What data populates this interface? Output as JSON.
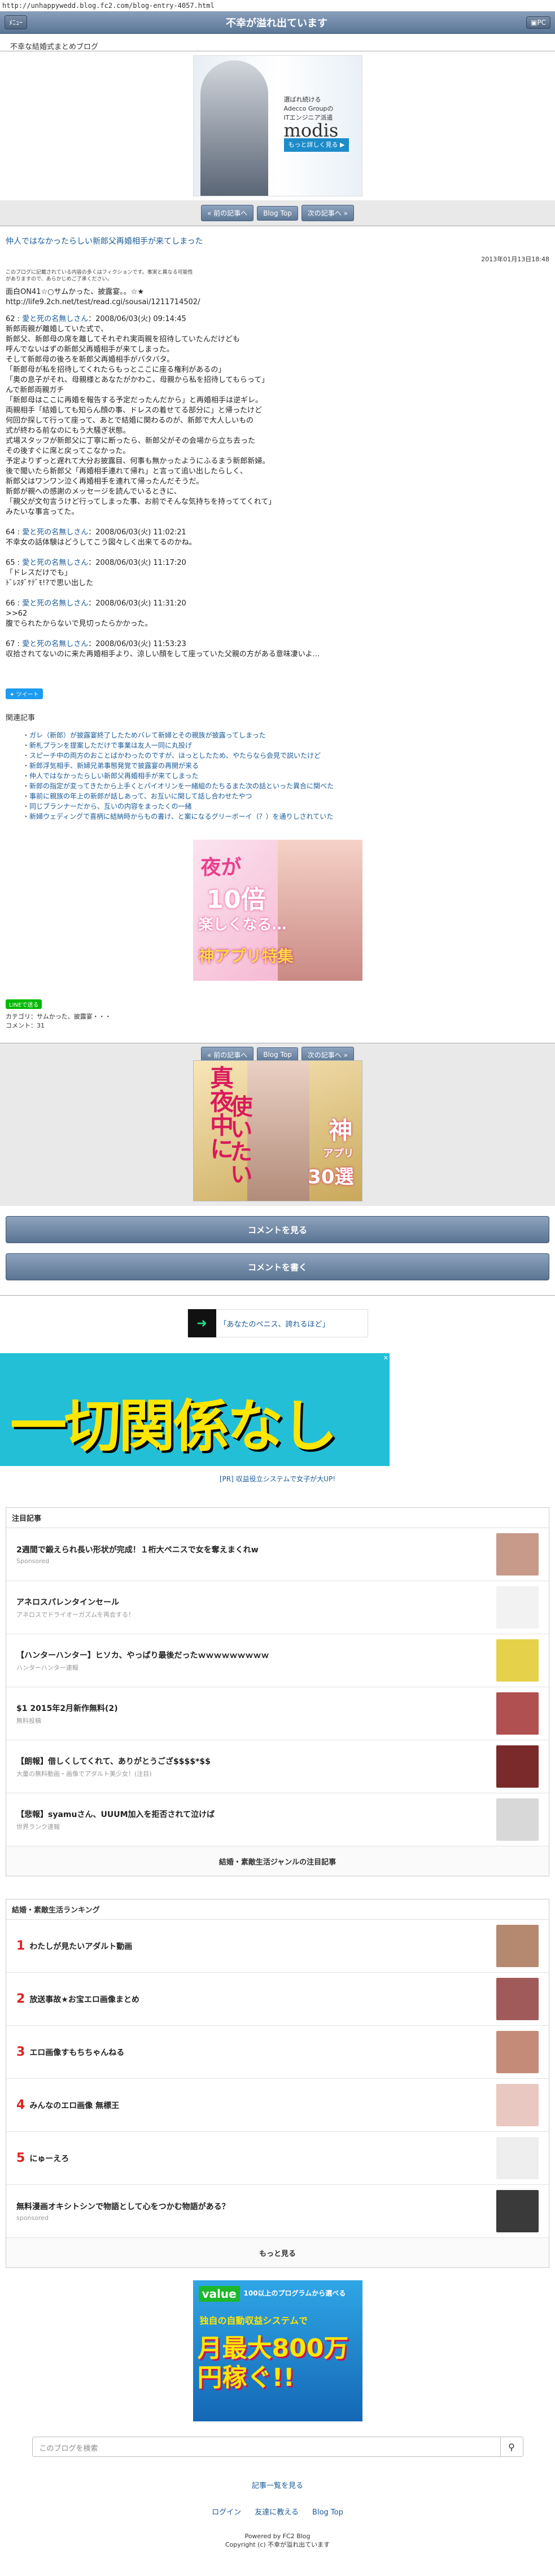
{
  "url": "http://unhappywedd.blog.fc2.com/blog-entry-4057.html",
  "header": {
    "left": "ﾒﾆｭｰ",
    "title": "不幸が溢れ出ています",
    "right": "PC"
  },
  "site_desc": "不幸な結婚式まとめブログ",
  "ad1": {
    "line1": "選ばれ続ける",
    "line2": "Adecco Groupの",
    "line3": "ITエンジニア派遣",
    "brand": "modis",
    "cta": "もっと詳しく見る ▶"
  },
  "pager": {
    "prev": "« 前の記事へ",
    "top": "Blog Top",
    "next": "次の記事へ »"
  },
  "entry": {
    "title": "仲人ではなかったらしい新郎父再婚相手が来てしまった",
    "date": "2013年01月13日18:48",
    "disclaimer": "このブログに記載されている内容の多くはフィクションです。事実と異なる可能性がありますので、あらかじめご了承ください。",
    "src_head": "面白ON41☆○サムかった、披露宴。。☆★",
    "src_url": "http://life9.2ch.net/test/read.cgi/sousai/1211714502/",
    "p1_header": "62 : ",
    "p1_name": "愛と死の名無しさん",
    "p1_date": "：2008/06/03(火) 09:14:45",
    "p1": [
      "新郎両親が離婚していた式で、",
      "新郎父、新郎母の席を離してそれぞれ実両親を招待していたんだけども",
      "呼んでないはずの新郎父再婚相手が来てしまった。",
      "そして新郎母の後ろを新郎父再婚相手がバタバタ。",
      "「新郎母が私を招待してくれたらもっとここに座る権利があるの」",
      "「奥の息子がそれ、母親様とあなたがかわこ、母親から私を招待してもらって」",
      "んで新郎両親ガチ",
      "「新郎母はここに再婚を報告する予定だったんだから」と再婚相手は逆ギレ。",
      "両親相手「結婚しても知らん顔の事、ドレスの着せてる部分に」と帰ったけど",
      "何回か探して行って座って、あとで結婚に関わるのが、新郎で大人しいもの",
      "式が終わる前なのにもう大騒ぎ状態。",
      "式場スタッフが新郎父に丁寧に断ったら、新郎父がその会場から立ち去った",
      "その後すぐに席と戻ってこなかった。",
      "予定よりずっと遅れて大分お披露目、何事も無かったようにふるまう新郎新婦。",
      "後で聞いたら新郎父「再婚相手連れて帰れ」と言って追い出したらしく、",
      "新郎父はワンワン泣く再婚相手を連れて帰ったんだそうだ。",
      "新郎が親への感謝のメッセージを読んでいるときに、",
      "「親父が文句言うけど行ってしまった事、お前でそんな気持ちを持っててくれて」",
      "みたいな事言ってた。"
    ],
    "p2_header": "64 : ",
    "p2_name": "愛と死の名無しさん",
    "p2_date": "：2008/06/03(火) 11:02:21",
    "p2": [
      "不幸女の話体験はどうしてこう図々しく出来てるのかね。"
    ],
    "p3_header": "65 : ",
    "p3_name": "愛と死の名無しさん",
    "p3_date": "：2008/06/03(火) 11:17:20",
    "p3": [
      "「ドレスだけでも」",
      "ﾄﾞﾚｽﾀﾞｹﾃﾞﾓ!?で思い出した"
    ],
    "p4_header": "66 : ",
    "p4_name": "愛と死の名無しさん",
    "p4_date": "：2008/06/03(火) 11:31:20",
    "p4": [
      ">>62",
      "腹でられたからないで見切ったらかかった。"
    ],
    "p5_header": "67 : ",
    "p5_name": "愛と死の名無しさん",
    "p5_date": "：2008/06/03(火) 11:53:23",
    "p5": [
      "収拾されてないのに来た再婚相手より、涼しい顔をして座っていた父親の方がある意味凄いよ…"
    ]
  },
  "tweet": "ツイート",
  "related": {
    "head": "関連記事",
    "items": [
      "ガレ（新郎）が披露宴終了したためバレて新婦とその親族が披露ってしまった",
      "新札プランを提案しただけで事業は友人一同に丸投げ",
      "スピーチ中の両方のおことばかわったのですが、ほっとしたため、やたらなら会見で説いたけど",
      "新郎浮気相手、新婦兄弟事態発覚で披露宴の再開が来る",
      "仲人ではなかったらしい新郎父再婚相手が来てしまった",
      "新郎の指定が変ってきたから上手くとパイオリンを一緒組のたちるまた次の話といった異合に関べた",
      "事前に親族の年上の新郎が話しあって、お互いに関して話し合わせたやつ",
      "同じブランナーだから、互いの内容をまったくの一緒",
      "新婦ウェディングで喜柄に結納時からもの書け、と案になるグリーボーイ（？）を通りしされていた"
    ]
  },
  "ad2": {
    "top": "夜が",
    "num": "10倍",
    "mid": "楽しくなる…",
    "bottom": "神アプリ特集"
  },
  "line_btn": "LINEで送る",
  "meta_cat": "カテゴリ：サムかった、披露宴・・・",
  "meta_cmt": "コメント：31",
  "ad3": {
    "l1": "真夜中に",
    "l2": "使いたい",
    "r1": "神",
    "r2": "アプリ",
    "r3": "30選"
  },
  "comment_btns": [
    "コメントを見る",
    "コメントを書く"
  ],
  "promo": {
    "text": "「あなたのペニス、誇れるほど」",
    "link": "https://fc2.com"
  },
  "banner": {
    "text": "一切関係なし"
  },
  "pr": "[PR] 収益役立システムで女子が大UP!",
  "attention": {
    "head": "注目記事",
    "items": [
      {
        "title": "2週間で鍛えられ長い形状が完成！１桁大ペニスで女を奪えまくれw",
        "sub": "Sponsored"
      },
      {
        "title": "アネロスパレンタインセール",
        "sub": "アネロスでドライオーガズムを再会する！"
      },
      {
        "title": "【ハンターハンター】ヒソカ、やっぱり最後だったｗｗｗｗｗｗｗｗｗ",
        "sub": "ハンターハンター速報"
      },
      {
        "title": "$1 2015年2月新作無料(2)",
        "sub": "無料投稿"
      },
      {
        "title": "【朗報】借しくしてくれて、ありがとうござ$$$$*$$",
        "sub": "大量の無料動画・画像でアダルト美少女！(注目)"
      },
      {
        "title": "【悲報】syamuさん、UUUM加入を拒否されて泣けば",
        "sub": "世界ランク速報"
      }
    ],
    "foot": "結婚・素敵生活ジャンルの注目記事"
  },
  "ranking": {
    "head": "結婚・素敵生活ランキング",
    "items": [
      {
        "n": "1",
        "title": "わたしが見たいアダルト動画",
        "sub": ""
      },
      {
        "n": "2",
        "title": "放送事故★お宝エロ画像まとめ",
        "sub": ""
      },
      {
        "n": "3",
        "title": "エロ画像すもちちゃんねる",
        "sub": ""
      },
      {
        "n": "4",
        "title": "みんなのエロ画像 無標王",
        "sub": ""
      },
      {
        "n": "5",
        "title": "にゅーえろ",
        "sub": ""
      },
      {
        "n": "",
        "title": "無料漫画オキシトシンで物語として心をつかむ物語がある？",
        "sub": "sponsored"
      }
    ],
    "foot": "もっと見る"
  },
  "ad4": {
    "top": "100以上のプログラムから選べる",
    "brand": "value",
    "main": "月最大800万円稼ぐ!!",
    "sub": "独自の自動収益システムで"
  },
  "search": {
    "placeholder": "このブログを検索"
  },
  "footer": {
    "list": "記事一覧を見る",
    "login": "ログイン",
    "friend": "友達に教える",
    "top": "Blog Top",
    "powered": "Powered by FC2 Blog",
    "copy": "Copyright (c) 不幸が溢れ出ています"
  }
}
